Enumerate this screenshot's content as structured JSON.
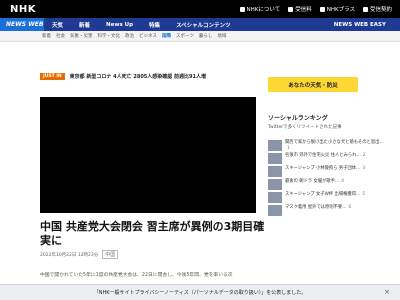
{
  "header": {
    "logo": "NHK",
    "top_links": [
      "NHKについて",
      "受信料",
      "NHKプラス",
      "受信契約"
    ]
  },
  "nav": {
    "brand": "NEWS WEB",
    "items": [
      "天気",
      "新着",
      "News Up",
      "特集",
      "スペシャルコンテンツ"
    ],
    "easy": "NEWS WEB EASY"
  },
  "categories": [
    "新着",
    "社会",
    "気象・災害",
    "科学・文化",
    "政治",
    "ビジネス",
    "国際",
    "スポーツ",
    "暮らし",
    "地域"
  ],
  "active_category": "国際",
  "breaking": {
    "badge": "JUST IN",
    "text": "東京都 新型コロナ 4人死亡 2805人感染確認 前週比91人増"
  },
  "article": {
    "headline": "中国 共産党大会閉会 習主席が異例の3期目確実に",
    "date": "2022年10月22日 12時23分",
    "share_label": "中国",
    "body_preview": "中国で開かれていた5年に1度の共産党大会は、22日に閉会し、今後5年間、党を率いる次"
  },
  "sidebar": {
    "ad_text": "あなたの天気・防災",
    "social_title": "ソーシャルランキング",
    "social_sub": "Twitterで多くリツイートされた記事",
    "ranking": [
      {
        "text": "関西で家から脱け出た小さな犬と猿もそのと思出…",
        "num": "1"
      },
      {
        "text": "名張市 郊外で住宅火災 住人とみられ…",
        "num": "2"
      },
      {
        "text": "スキージャンプ 小林陵侑ら 男子団体…",
        "num": "3"
      },
      {
        "text": "最後の 朝ドラ 女優が歌手…",
        "num": "4"
      },
      {
        "text": "スキージャンプ 女子W杯 出場権獲得…",
        "num": "5"
      },
      {
        "text": "マスク着用 屋外では原則不要…",
        "num": "6"
      }
    ]
  },
  "footer": {
    "text": "「NHK一般サイトプライバシーノーティス（パーソナルデータの取り扱い）」を公表しました。",
    "close": "×"
  },
  "colors": {
    "top_bar": "#000000",
    "nav_bar": "#1f3a93",
    "brand": "#1c6fd8",
    "justin": "#e66b00",
    "ad": "#fdd835"
  }
}
